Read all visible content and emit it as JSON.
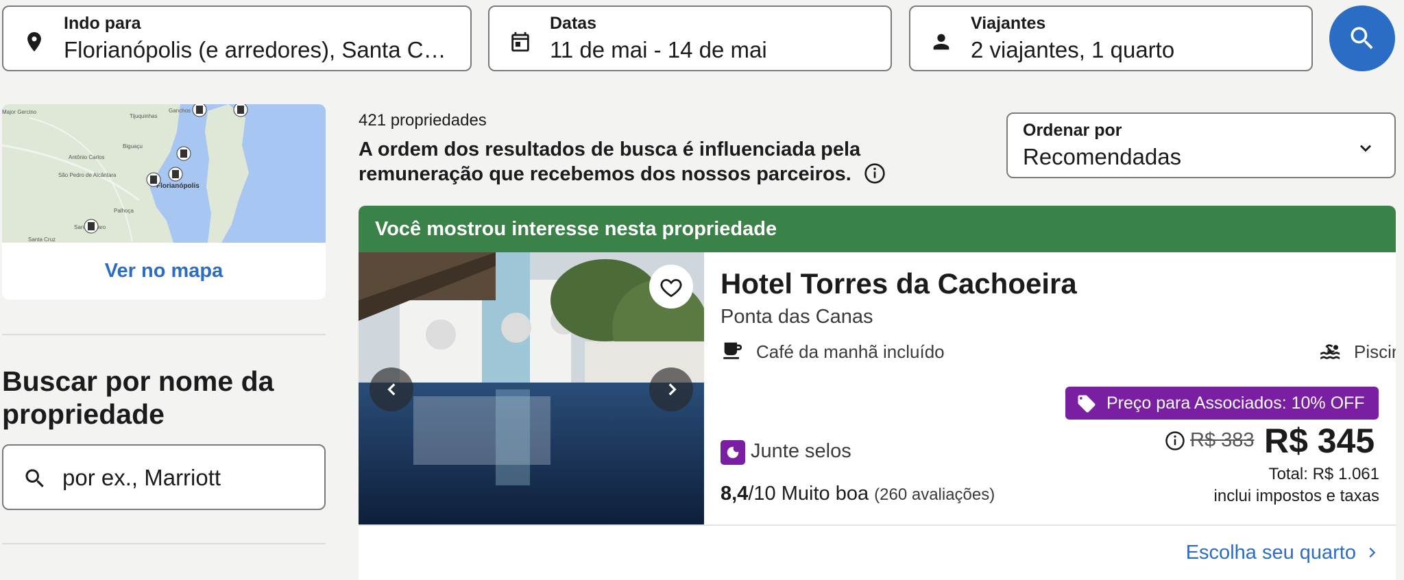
{
  "search": {
    "destination": {
      "label": "Indo para",
      "value": "Florianópolis (e arredores), Santa Catarina, Brasil",
      "icon": "location-pin-icon"
    },
    "dates": {
      "label": "Datas",
      "value": "11 de mai - 14 de mai",
      "icon": "calendar-icon"
    },
    "travelers": {
      "label": "Viajantes",
      "value": "2 viajantes, 1 quarto",
      "icon": "person-icon"
    },
    "button_icon": "search-icon"
  },
  "sidebar": {
    "map_labels": {
      "a": "Ganchos",
      "b": "Tijuquinhas",
      "c": "Biguaçu",
      "d": "Antônio Carlos",
      "e": "São Pedro de Alcântara",
      "f": "Florianópolis",
      "g": "Palhoça",
      "h": "Santo Amaro",
      "i": "Santa Cruz",
      "j": "Major Gercino"
    },
    "map_link": "Ver no mapa",
    "search_name_title": "Buscar por nome da propriedade",
    "search_name_placeholder": "por ex., Marriott"
  },
  "results": {
    "count": "421 propriedades",
    "disclaimer": "A ordem dos resultados de busca é influenciada pela remuneração que recebemos dos nossos parceiros.",
    "sort": {
      "label": "Ordenar por",
      "value": "Recomendadas"
    }
  },
  "listing": {
    "banner": "Você mostrou interesse nesta propriedade",
    "name": "Hotel Torres da Cachoeira",
    "location": "Ponta das Canas",
    "amenities": [
      {
        "label": "Café da manhã incluído",
        "icon": "coffee-cup-icon"
      },
      {
        "label": "Piscina",
        "icon": "pool-icon"
      }
    ],
    "deal": "Preço para Associados: 10% OFF",
    "stamps": "Junte selos",
    "rating": {
      "score": "8,4",
      "scale": "/10",
      "text": "Muito boa",
      "reviews": "(260 avaliações)"
    },
    "old_price": "R$ 383",
    "price": "R$ 345",
    "total": "Total: R$ 1.061",
    "taxes": "inclui impostos e taxas",
    "cta": "Escolha seu quarto"
  },
  "colors": {
    "primary": "#2b6cc4",
    "banner": "#3b8249",
    "deal": "#7b1fa2"
  }
}
